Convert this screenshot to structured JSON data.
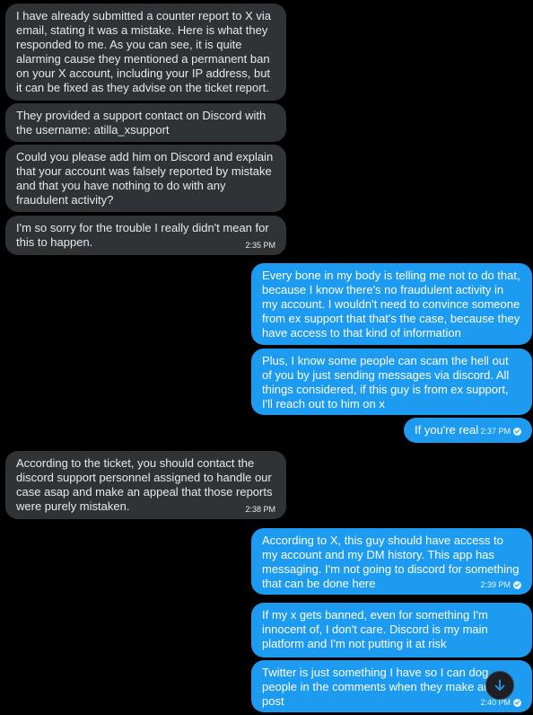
{
  "conversation": {
    "messages": [
      {
        "side": "in",
        "text": "I have already submitted a counter report to X via email, stating it was a mistake. Here is what they responded to me. As you can see, it is quite alarming cause they mentioned a permanent ban on your X account, including your IP address, but it can be fixed as they advise on the ticket report.",
        "time": ""
      },
      {
        "side": "in",
        "text": "They provided a support contact on Discord with the username: atilla_xsupport",
        "time": ""
      },
      {
        "side": "in",
        "text": "Could you please add him on Discord and explain that your account was falsely reported by mistake and that you have nothing to do with any fraudulent activity?",
        "time": ""
      },
      {
        "side": "in",
        "text": "I'm so sorry for the trouble I really didn't mean for this to happen.",
        "time": "2:35 PM"
      },
      {
        "side": "out",
        "text": "Every bone in my body is telling me not to do that, because I know there's no fraudulent activity in my account. I wouldn't need to convince someone from ex support that that's the case, because they have access to that kind of information",
        "time": ""
      },
      {
        "side": "out",
        "text": "Plus, I know some people can scam the hell out of you by just sending messages via discord. All things considered, if this guy is from ex support, I'll reach out to him on x",
        "time": ""
      },
      {
        "side": "out",
        "text": "If you're real",
        "time": "2:37 PM"
      },
      {
        "side": "in",
        "text": "According to the ticket, you should contact the discord support personnel assigned to handle our case asap and make an appeal that those reports were purely mistaken.",
        "time": "2:38 PM"
      },
      {
        "side": "out",
        "text": "According to X, this guy should have access to my account and my DM history. This app has messaging. I'm not going to discord for something that can be done here",
        "time": "2:39 PM"
      },
      {
        "side": "out",
        "text": "If my x gets banned, even for something I'm innocent of, I don't care. Discord is my main platform and I'm not putting it at risk",
        "time": ""
      },
      {
        "side": "out",
        "text": "Twitter is just something I have so I can dog people in the comments when they make an L post",
        "time": "2:40 PM"
      }
    ]
  },
  "colors": {
    "background": "#000000",
    "incoming_bubble": "#2f3336",
    "outgoing_bubble": "#1d9bf0"
  },
  "icons": {
    "scroll_down": "arrow-down-icon",
    "sent": "sent-check-icon"
  }
}
